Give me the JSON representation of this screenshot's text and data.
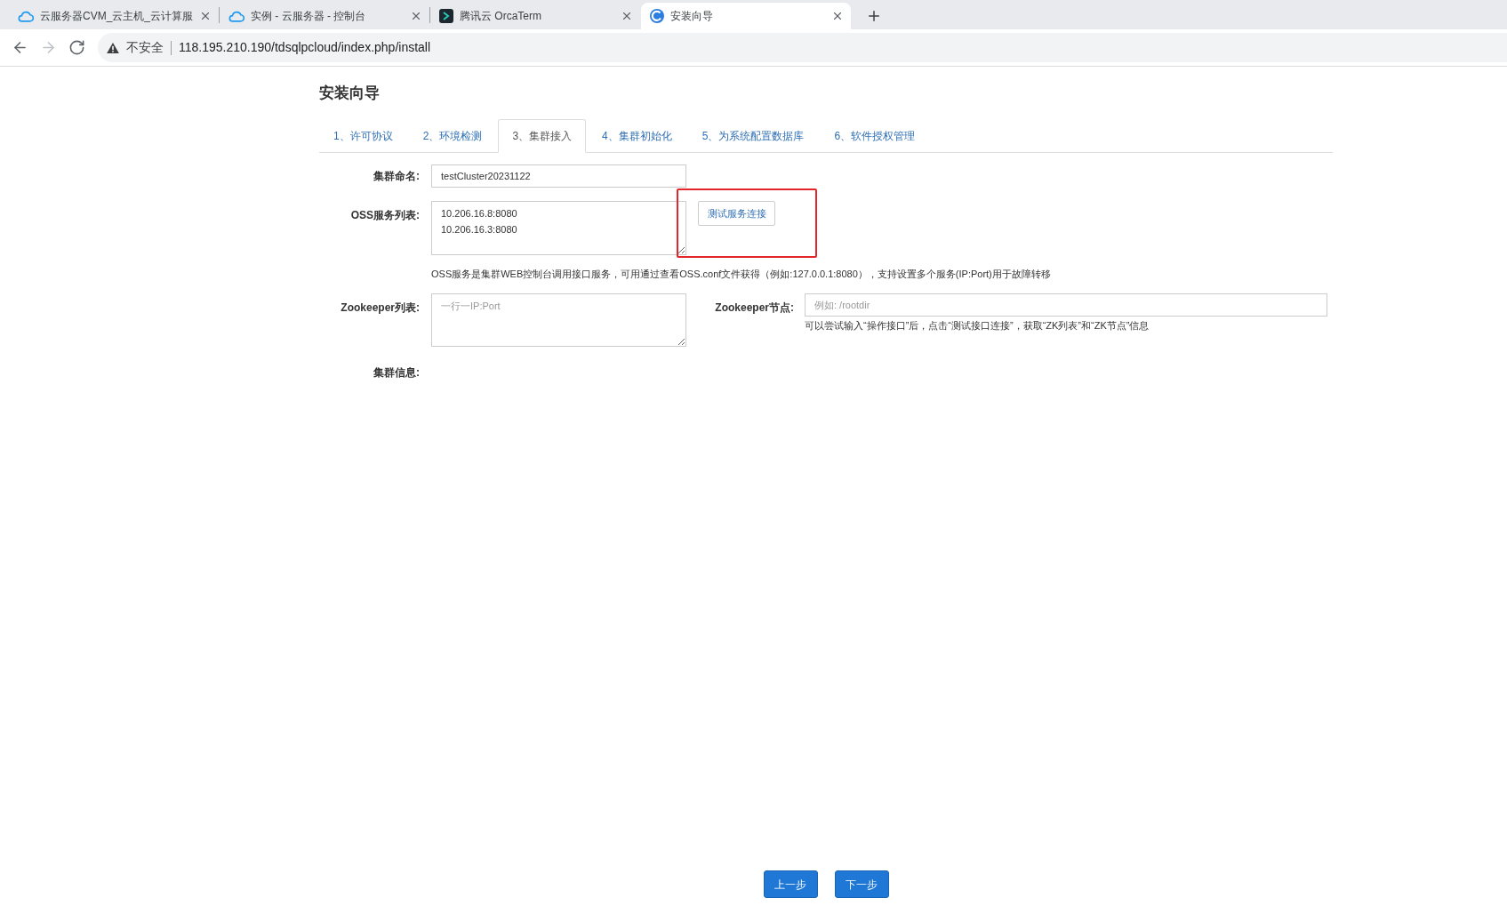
{
  "browser": {
    "tabs": [
      {
        "title": "云服务器CVM_云主机_云计算服",
        "kind": "cloud",
        "selected": false
      },
      {
        "title": "实例 - 云服务器 - 控制台",
        "kind": "cloud",
        "selected": false
      },
      {
        "title": "腾讯云 OrcaTerm",
        "kind": "terminal",
        "selected": false
      },
      {
        "title": "安装向导",
        "kind": "swirl",
        "selected": true
      }
    ],
    "nav_buttons": [
      {
        "kind": "back",
        "disabled": false
      },
      {
        "kind": "forward",
        "disabled": true
      },
      {
        "kind": "reload",
        "disabled": false
      }
    ],
    "address_bar": {
      "security_label": "不安全",
      "url": "118.195.210.190/tdsqlpcloud/index.php/install"
    }
  },
  "page": {
    "title": "安装向导",
    "steps": [
      {
        "label": "1、许可协议",
        "selected": false
      },
      {
        "label": "2、环境检测",
        "selected": false
      },
      {
        "label": "3、集群接入",
        "selected": true
      },
      {
        "label": "4、集群初始化",
        "selected": false
      },
      {
        "label": "5、为系统配置数据库",
        "selected": false
      },
      {
        "label": "6、软件授权管理",
        "selected": false
      }
    ],
    "form": {
      "cluster_name": {
        "label": "集群命名:",
        "value": "testCluster20231122"
      },
      "oss_services": {
        "label": "OSS服务列表:",
        "value": "10.206.16.8:8080\n10.206.16.3:8080",
        "test_button": "测试服务连接",
        "help": "OSS服务是集群WEB控制台调用接口服务，可用通过查看OSS.conf文件获得（例如:127.0.0.1:8080），支持设置多个服务(IP:Port)用于故障转移"
      },
      "zookeeper_list": {
        "label": "Zookeeper列表:",
        "placeholder": "一行一IP:Port"
      },
      "zookeeper_node": {
        "label": "Zookeeper节点:",
        "placeholder": "例如: /rootdir",
        "help": "可以尝试输入“操作接口”后，点击“测试接口连接”，获取“ZK列表”和“ZK节点”信息"
      },
      "cluster_info": {
        "label": "集群信息:"
      }
    },
    "buttons": [
      "上一步",
      "下一步"
    ]
  }
}
